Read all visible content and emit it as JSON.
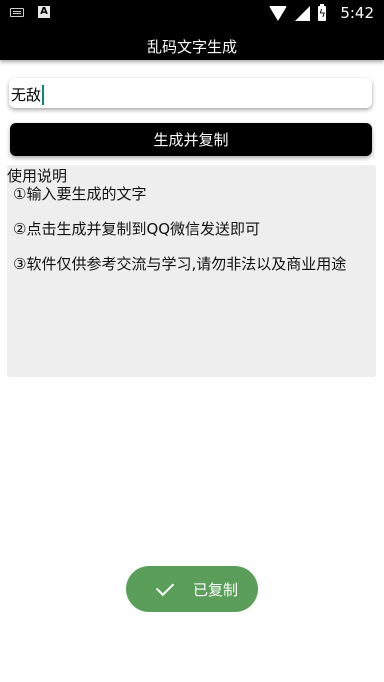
{
  "status_bar": {
    "time": "5:42",
    "left_icons": [
      "keyboard-icon",
      "font-a-icon"
    ],
    "right_icons": [
      "wifi-icon",
      "signal-icon",
      "battery-charging-icon"
    ],
    "a_glyph": "A"
  },
  "app_bar": {
    "title": "乱码文字生成"
  },
  "input": {
    "value": "无敌"
  },
  "generate_button": {
    "label": "生成并复制"
  },
  "instructions": {
    "title": "使用说明",
    "lines": [
      "①输入要生成的文字",
      "②点击生成并复制到QQ微信发送即可",
      "③软件仅供参考交流与学习,请勿非法以及商业用途"
    ]
  },
  "toast": {
    "label": "已复制",
    "icon": "check-icon"
  },
  "colors": {
    "bar": "#000000",
    "panel": "#eeeeee",
    "toast": "#5a9e5a",
    "caret": "#0a8a7a"
  }
}
